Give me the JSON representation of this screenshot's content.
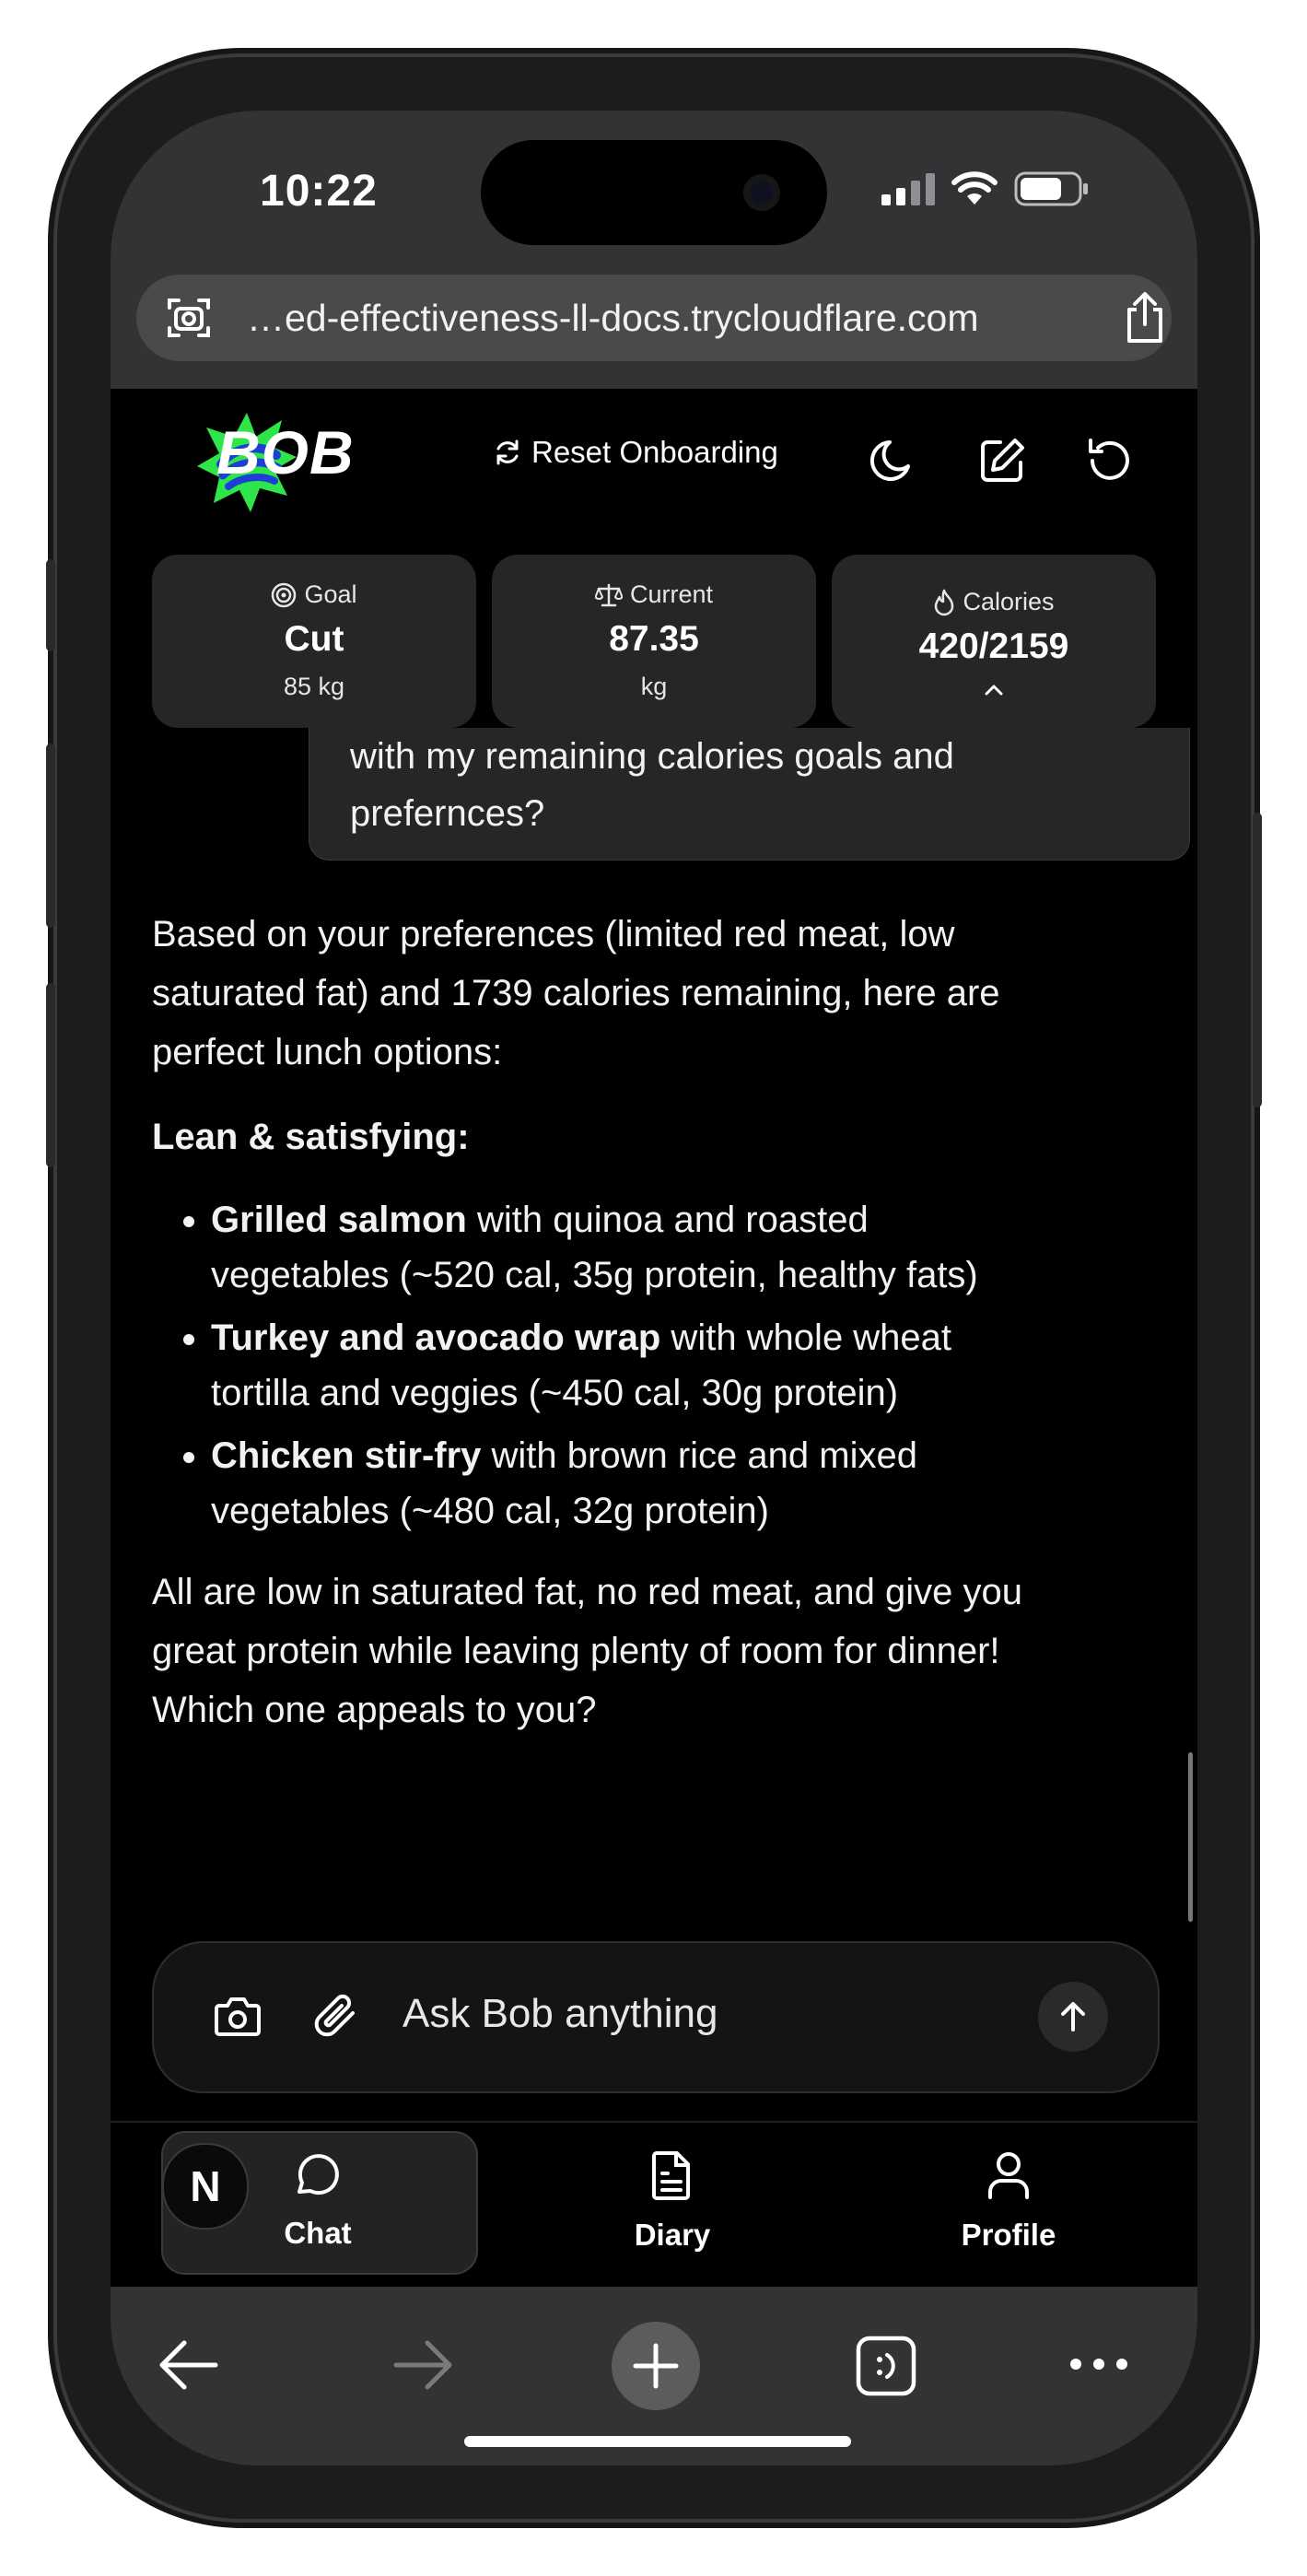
{
  "status_bar": {
    "time": "10:22"
  },
  "browser": {
    "url": "…ed-effectiveness-ll-docs.trycloudflare.com"
  },
  "header": {
    "brand": "BOB",
    "reset_label": "Reset Onboarding"
  },
  "stats": {
    "goal": {
      "label": "Goal",
      "value": "Cut",
      "unit": "85 kg"
    },
    "current": {
      "label": "Current",
      "value": "87.35",
      "unit": "kg"
    },
    "calories": {
      "label": "Calories",
      "value": "420/2159"
    }
  },
  "chat": {
    "user_message_line1": "with my remaining calories goals and",
    "user_message_line2": "prefernces?",
    "assistant_intro": "Based on your preferences (limited red meat, low saturated fat) and 1739 calories remaining, here are perfect lunch options:",
    "assistant_heading": "Lean & satisfying:",
    "options": [
      {
        "name": "Grilled salmon",
        "detail": " with quinoa and roasted vegetables (~520 cal, 35g protein, healthy fats)"
      },
      {
        "name": "Turkey and avocado wrap",
        "detail": " with whole wheat tortilla and veggies (~450 cal, 30g protein)"
      },
      {
        "name": "Chicken stir-fry",
        "detail": " with brown rice and mixed vegetables (~480 cal, 32g protein)"
      }
    ],
    "assistant_outro": "All are low in saturated fat, no red meat, and give you great protein while leaving plenty of room for dinner! Which one appeals to you?"
  },
  "input": {
    "placeholder": "Ask Bob anything"
  },
  "nav": {
    "avatar_initial": "N",
    "chat": "Chat",
    "diary": "Diary",
    "profile": "Profile"
  },
  "colors": {
    "background": "#000000",
    "card": "#262628",
    "brand_green": "#2ee64a",
    "brand_blue": "#1e3fd6"
  }
}
